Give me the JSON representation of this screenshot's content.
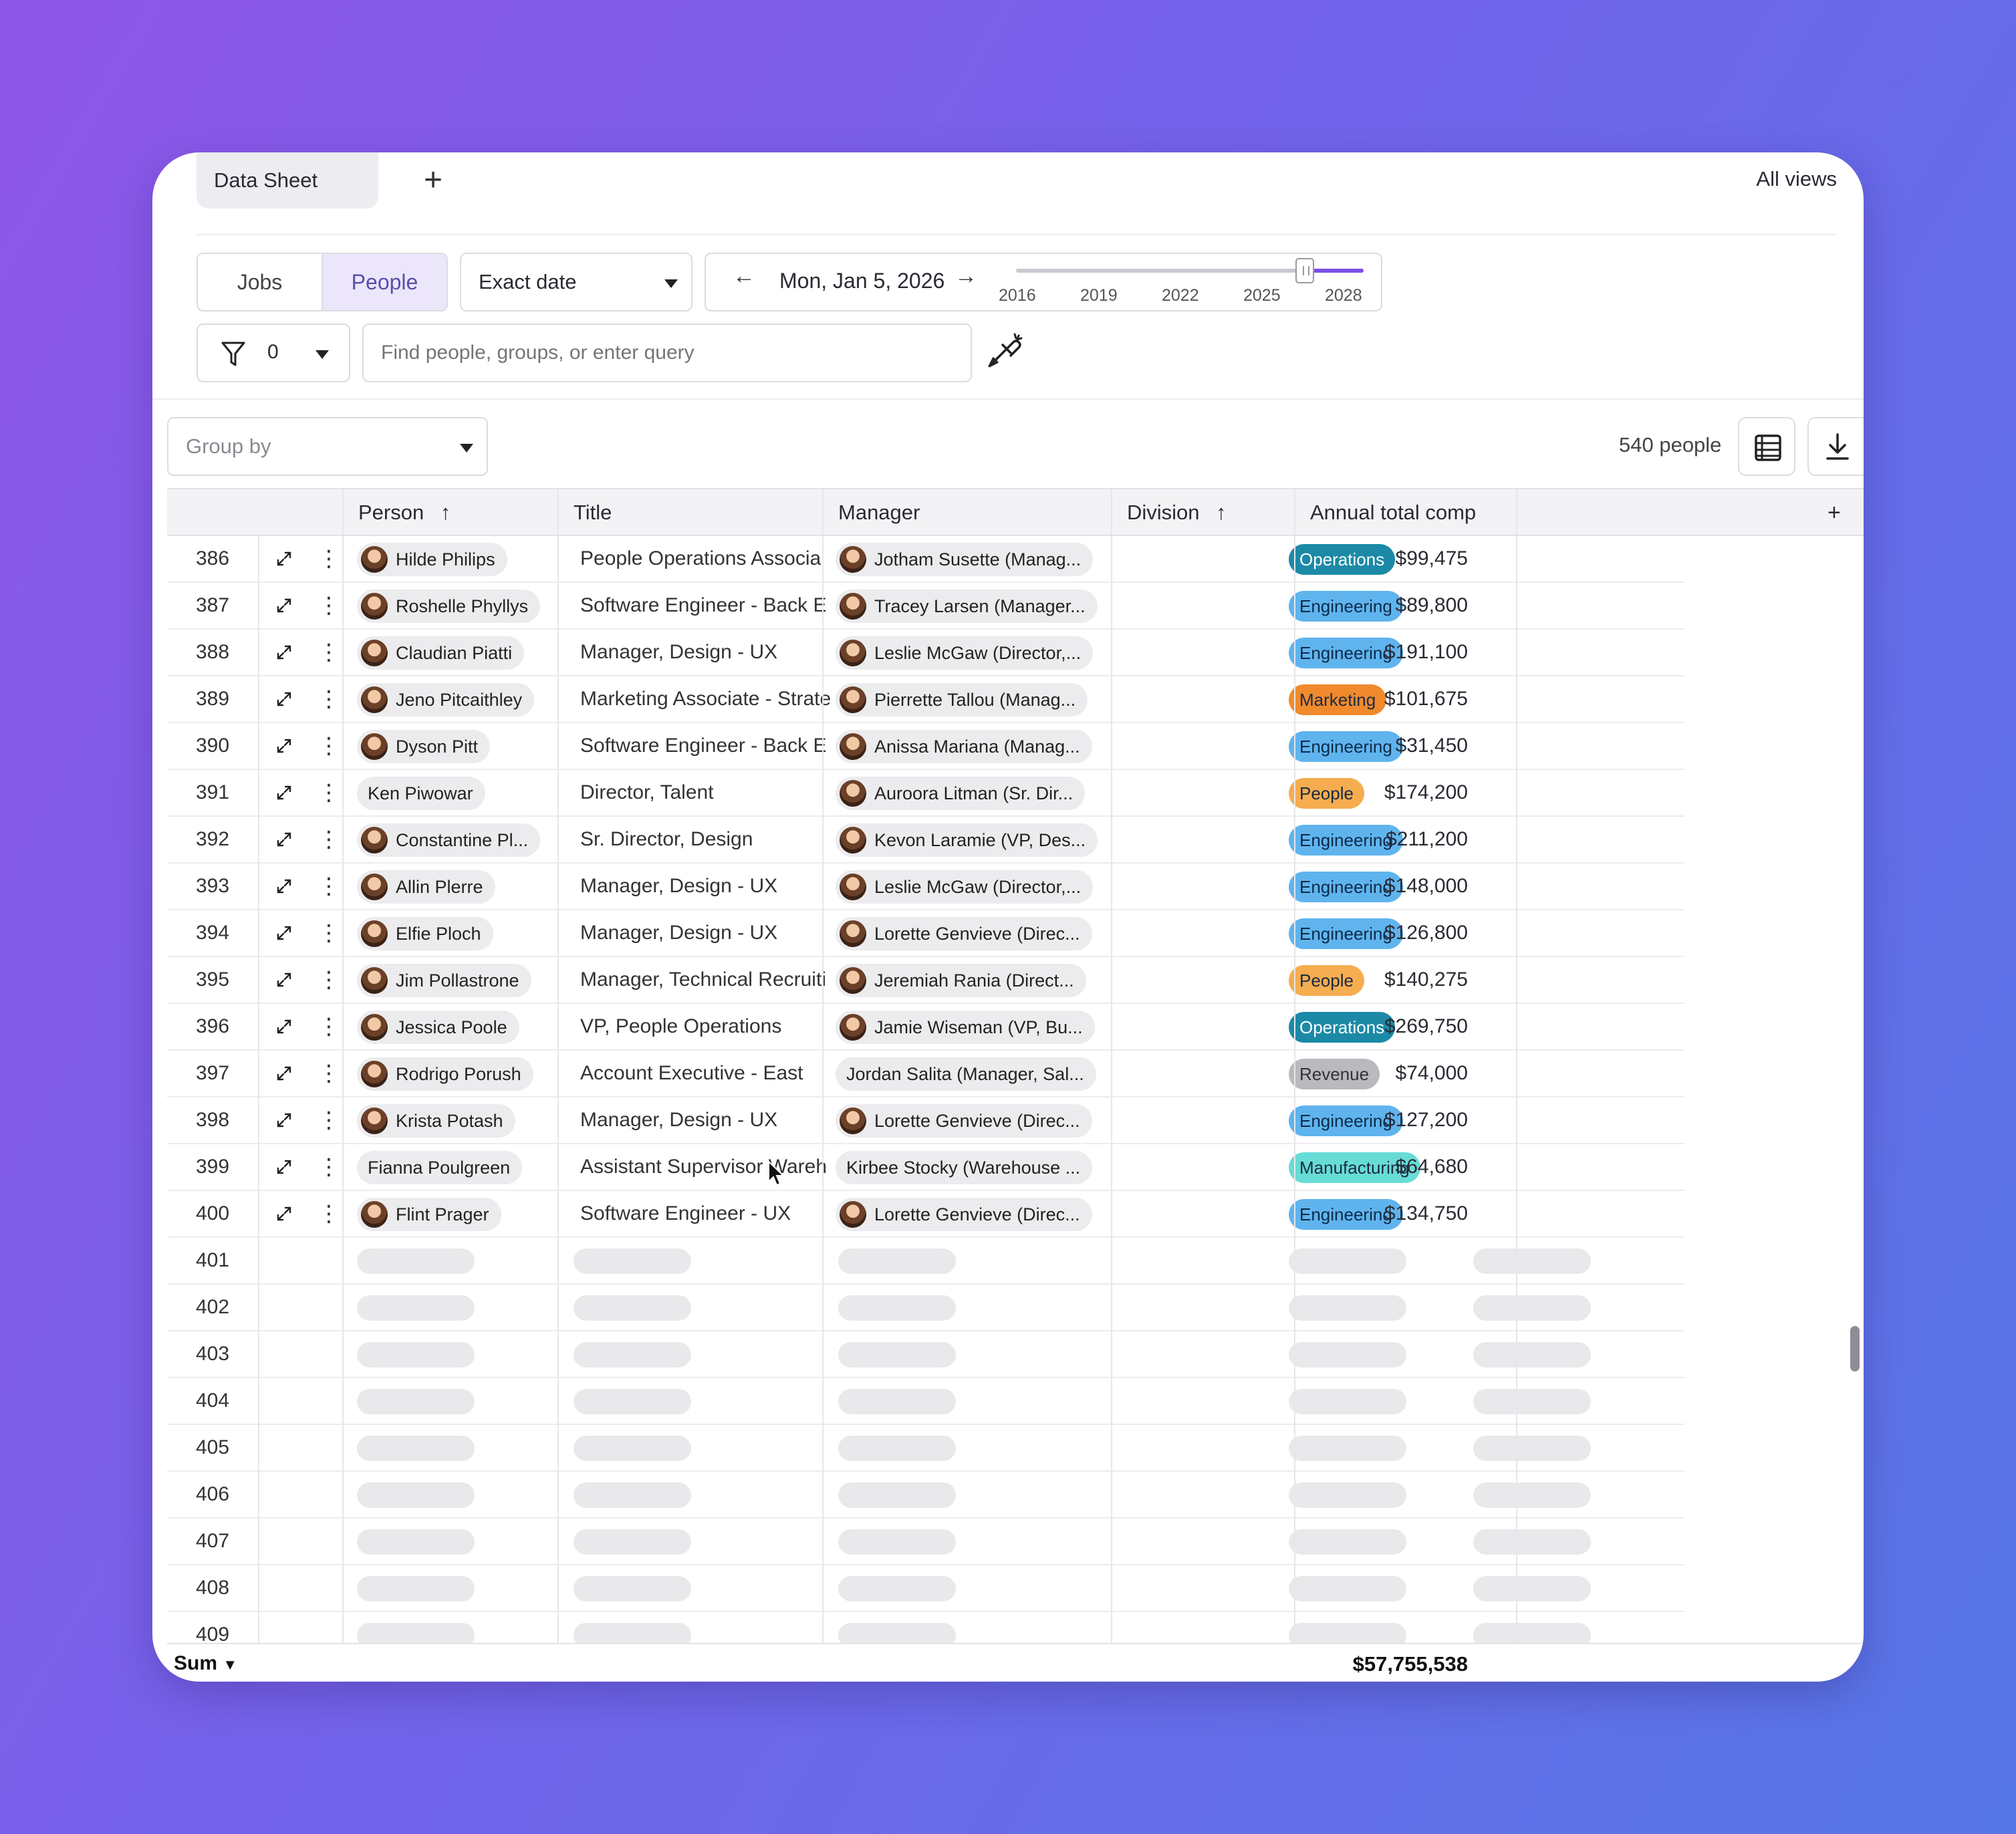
{
  "tabs": {
    "active": "Data Sheet",
    "add": "+",
    "all_views": "All views"
  },
  "toolbar": {
    "mode_jobs": "Jobs",
    "mode_people": "People",
    "date_type": "Exact date",
    "date": "Mon, Jan 5, 2026",
    "prev": "←",
    "next": "→",
    "timeline_ticks": [
      "2016",
      "2019",
      "2022",
      "2025",
      "2028"
    ],
    "timeline_position": 0.83,
    "filter_count": "0",
    "search_placeholder": "Find people, groups, or enter query"
  },
  "view": {
    "group_by_placeholder": "Group by",
    "people_count": "540 people"
  },
  "table": {
    "columns": {
      "person": "Person",
      "title": "Title",
      "manager": "Manager",
      "division": "Division",
      "comp": "Annual total comp",
      "add": "+"
    },
    "sort_arrow": "↑",
    "rows": [
      {
        "num": "386",
        "person": "Hilde Philips",
        "avatar": true,
        "title": "People Operations Associa",
        "manager": "Jotham Susette (Manag...",
        "division": "Operations",
        "comp": "$99,475"
      },
      {
        "num": "387",
        "person": "Roshelle Phyllys",
        "avatar": true,
        "title": "Software Engineer - Back E",
        "manager": "Tracey Larsen (Manager...",
        "division": "Engineering",
        "comp": "$89,800"
      },
      {
        "num": "388",
        "person": "Claudian Piatti",
        "avatar": true,
        "title": "Manager, Design - UX",
        "manager": "Leslie McGaw (Director,...",
        "division": "Engineering",
        "comp": "$191,100"
      },
      {
        "num": "389",
        "person": "Jeno Pitcaithley",
        "avatar": true,
        "title": "Marketing Associate - Strate",
        "manager": "Pierrette Tallou (Manag...",
        "division": "Marketing",
        "comp": "$101,675"
      },
      {
        "num": "390",
        "person": "Dyson Pitt",
        "avatar": true,
        "title": "Software Engineer - Back E",
        "manager": "Anissa Mariana (Manag...",
        "division": "Engineering",
        "comp": "$31,450"
      },
      {
        "num": "391",
        "person": "Ken Piwowar",
        "avatar": false,
        "title": "Director, Talent",
        "manager": "Auroora Litman (Sr. Dir...",
        "division": "People",
        "comp": "$174,200"
      },
      {
        "num": "392",
        "person": "Constantine Pl...",
        "avatar": true,
        "title": "Sr. Director, Design",
        "manager": "Kevon Laramie (VP, Des...",
        "division": "Engineering",
        "comp": "$211,200"
      },
      {
        "num": "393",
        "person": "Allin Plerre",
        "avatar": true,
        "title": "Manager, Design - UX",
        "manager": "Leslie McGaw (Director,...",
        "division": "Engineering",
        "comp": "$148,000"
      },
      {
        "num": "394",
        "person": "Elfie Ploch",
        "avatar": true,
        "title": "Manager, Design - UX",
        "manager": "Lorette Genvieve (Direc...",
        "division": "Engineering",
        "comp": "$126,800"
      },
      {
        "num": "395",
        "person": "Jim Pollastrone",
        "avatar": true,
        "title": "Manager, Technical Recruiti",
        "manager": "Jeremiah Rania (Direct...",
        "division": "People",
        "comp": "$140,275"
      },
      {
        "num": "396",
        "person": "Jessica Poole",
        "avatar": true,
        "title": "VP, People Operations",
        "manager": "Jamie Wiseman (VP, Bu...",
        "division": "Operations",
        "comp": "$269,750"
      },
      {
        "num": "397",
        "person": "Rodrigo Porush",
        "avatar": true,
        "title": "Account Executive - East",
        "manager": "Jordan Salita (Manager, Sal...",
        "division": "Revenue",
        "comp": "$74,000"
      },
      {
        "num": "398",
        "person": "Krista Potash",
        "avatar": true,
        "title": "Manager, Design - UX",
        "manager": "Lorette Genvieve (Direc...",
        "division": "Engineering",
        "comp": "$127,200"
      },
      {
        "num": "399",
        "person": "Fianna Poulgreen",
        "avatar": false,
        "title": "Assistant Supervisor Wareh",
        "manager": "Kirbee Stocky (Warehouse ...",
        "division": "Manufacturing",
        "comp": "$64,680"
      },
      {
        "num": "400",
        "person": "Flint Prager",
        "avatar": true,
        "title": "Software Engineer - UX",
        "manager": "Lorette Genvieve (Direc...",
        "division": "Engineering",
        "comp": "$134,750"
      }
    ],
    "loading_rows": [
      "401",
      "402",
      "403",
      "404",
      "405",
      "406",
      "407",
      "408",
      "409"
    ],
    "manager_avatar_missing": [
      "397",
      "399"
    ],
    "footer": {
      "label": "Sum",
      "total": "$57,755,538"
    }
  },
  "colors": {
    "Operations": "#1c8aa6",
    "Engineering": "#5fb4ee",
    "Marketing": "#f08a2c",
    "People": "#f5ad4f",
    "Revenue": "#b9b9be",
    "Manufacturing": "#67dcd6",
    "accent": "#7c4fe8"
  }
}
